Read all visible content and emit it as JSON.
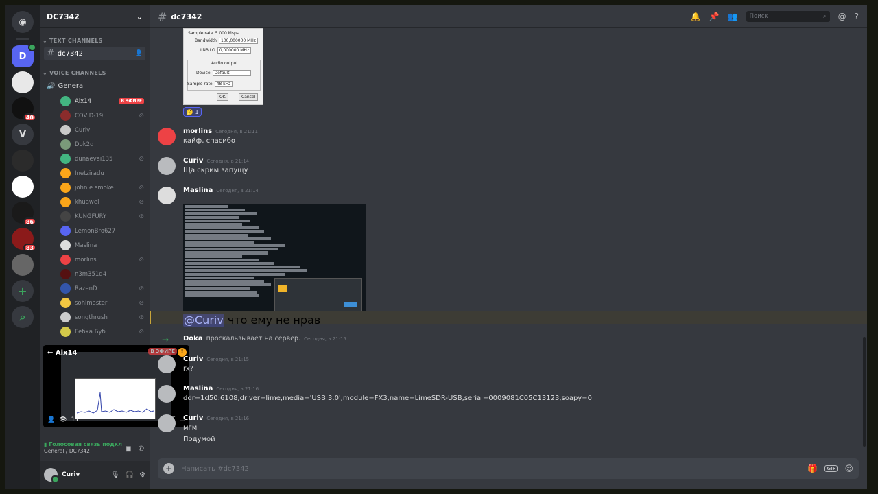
{
  "servers": [
    {
      "label": "",
      "icon": "discord-logo-icon",
      "color": "#36393f"
    },
    {
      "label": "D",
      "icon": "",
      "color": "#5865f2",
      "active": true,
      "voice": true
    },
    {
      "label": "",
      "icon": "ctf-server-icon",
      "color": "#e8e8e8"
    },
    {
      "label": "",
      "icon": "dark-server-icon",
      "color": "#111111",
      "badge": "40"
    },
    {
      "label": "V",
      "icon": "",
      "color": "#36393f"
    },
    {
      "label": "",
      "icon": "grid-server-icon",
      "color": "#2b2b2b"
    },
    {
      "label": "",
      "icon": "ctf-flag-server-icon",
      "color": "#ffffff"
    },
    {
      "label": "",
      "icon": "cube-server-icon",
      "color": "#1a1a1a",
      "badge": "86"
    },
    {
      "label": "",
      "icon": "red-server-icon",
      "color": "#8b1a1a",
      "badge": "83"
    },
    {
      "label": "",
      "icon": "penguin-server-icon",
      "color": "#666666"
    }
  ],
  "guild": {
    "name": "DC7342"
  },
  "categories": {
    "text": "TEXT CHANNELS",
    "voice": "VOICE CHANNELS"
  },
  "text_channel": {
    "name": "dc7342"
  },
  "voice_channel": {
    "name": "General"
  },
  "voice_members": [
    {
      "name": "Alx14",
      "color": "#43b581",
      "live": "В ЭФИРЕ"
    },
    {
      "name": "COVID-19",
      "color": "#8b2c2c",
      "muted": true
    },
    {
      "name": "Curiv",
      "color": "#c9c9c9"
    },
    {
      "name": "Dok2d",
      "color": "#7a9a7a"
    },
    {
      "name": "dunaevai135",
      "color": "#43b581",
      "muted": true
    },
    {
      "name": "Inetziradu",
      "color": "#faa61a"
    },
    {
      "name": "john e smoke",
      "color": "#faa61a",
      "muted": true
    },
    {
      "name": "khuawei",
      "color": "#faa61a",
      "muted": true
    },
    {
      "name": "KUNGFURY",
      "color": "#444444",
      "muted": true
    },
    {
      "name": "LemonBro627",
      "color": "#5865f2"
    },
    {
      "name": "Maslina",
      "color": "#dddddd"
    },
    {
      "name": "morlins",
      "color": "#ed4245",
      "muted": true
    },
    {
      "name": "n3m351d4",
      "color": "#551111"
    },
    {
      "name": "RazenD",
      "color": "#3355aa",
      "muted": true
    },
    {
      "name": "sohimaster",
      "color": "#f4c842",
      "muted": true
    },
    {
      "name": "songthrush",
      "color": "#cccccc",
      "muted": true
    },
    {
      "name": "Гебка Буб",
      "color": "#d4c94a",
      "muted": true
    }
  ],
  "stream": {
    "user": "Alx14",
    "live": "В ЭФИРЕ",
    "viewers": "11"
  },
  "voice_status": {
    "connected": "Голосовая связь подкл",
    "location": "General / DC7342"
  },
  "user": {
    "name": "Curiv"
  },
  "topbar": {
    "search_placeholder": "Поиск"
  },
  "settings_image": {
    "sample_rate_label": "Sample rate",
    "sample_rate_value": "5.000 Msps",
    "bandwidth_label": "Bandwidth",
    "bandwidth_value": "100,000000 MHz",
    "lnb_label": "LNB LO",
    "lnb_value": "0,000000 MHz",
    "audio_output": "Audio output",
    "device_label": "Device",
    "device_value": "Default",
    "audio_rate_label": "Sample rate",
    "audio_rate_value": "48 kHz",
    "ok": "OK",
    "cancel": "Cancel"
  },
  "reaction": {
    "emoji": "🤔",
    "count": "1"
  },
  "messages": [
    {
      "author": "morlins",
      "time": "Сегодня, в 21:11",
      "text": "кайф, спасибо",
      "color": "#ed4245"
    },
    {
      "author": "Curiv",
      "time": "Сегодня, в 21:14",
      "text": "Ща скрим запущу",
      "color": "#b9bbbe"
    },
    {
      "author": "Maslina",
      "time": "Сегодня, в 21:14",
      "color": "#dddddd"
    }
  ],
  "mention_message": {
    "mention": "@Curiv",
    "text": " что ему не нрав"
  },
  "system_message": {
    "author": "Doka",
    "text": "проскальзывает на сервер.",
    "time": "Сегодня, в 21:15"
  },
  "later_messages": [
    {
      "author": "Curiv",
      "time": "Сегодня, в 21:15",
      "lines": [
        "rx?"
      ]
    },
    {
      "author": "Maslina",
      "time": "Сегодня, в 21:16",
      "lines": [
        "ddr=1d50:6108,driver=lime,media='USB 3.0',module=FX3,name=LimeSDR-USB,serial=0009081C05C13123,soapy=0"
      ]
    },
    {
      "author": "Curiv",
      "time": "Сегодня, в 21:16",
      "lines": [
        "мгм",
        "Подумой"
      ]
    }
  ],
  "composer": {
    "placeholder": "Написать #dc7342"
  }
}
